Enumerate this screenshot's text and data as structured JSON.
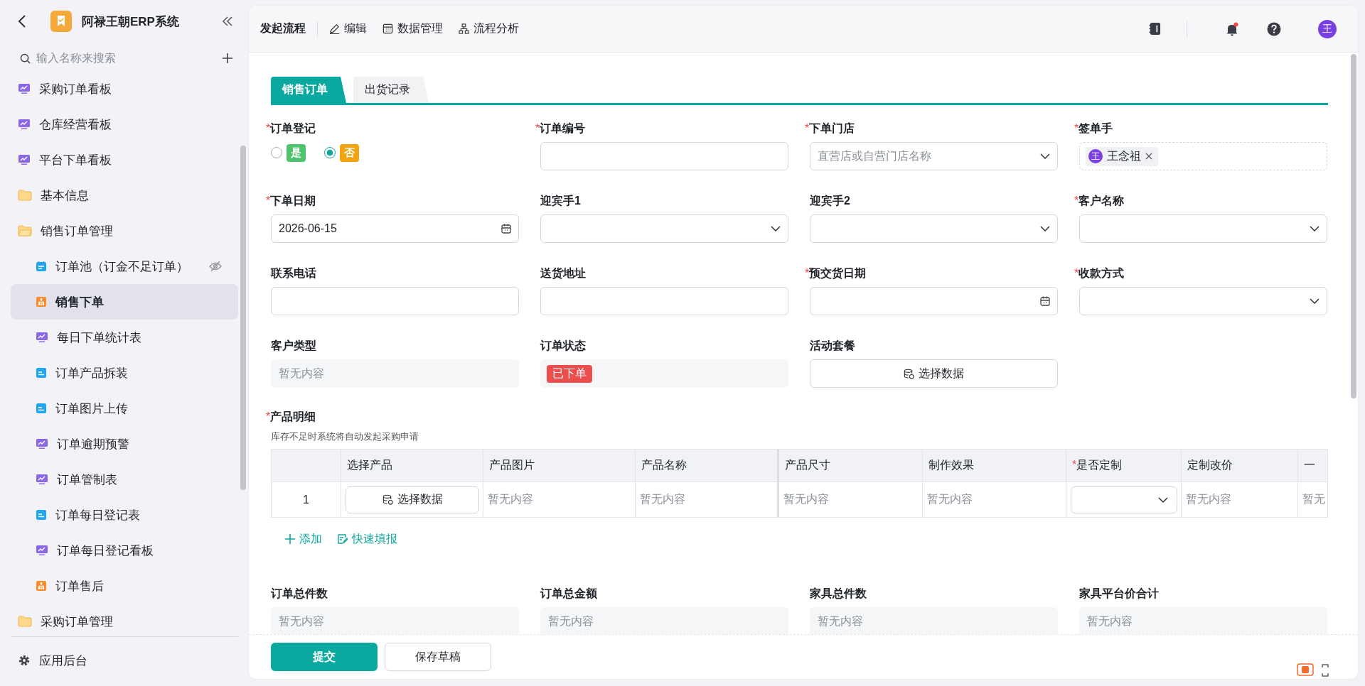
{
  "sidebar": {
    "title": "阿禄王朝ERP系统",
    "search": {
      "placeholder": "输入名称来搜索"
    },
    "items": [
      {
        "label": "采购订单看板",
        "kind": "chart",
        "selected": false
      },
      {
        "label": "仓库经营看板",
        "kind": "chart",
        "selected": false
      },
      {
        "label": "平台下单看板",
        "kind": "chart",
        "selected": false
      },
      {
        "label": "基本信息",
        "kind": "folder",
        "expanded": false,
        "selected": false
      },
      {
        "label": "销售订单管理",
        "kind": "folder",
        "expanded": true,
        "selected": false,
        "children": [
          {
            "label": "订单池（订金不足订单）",
            "kind": "calendar",
            "selected": false,
            "hidden": true
          },
          {
            "label": "销售下单",
            "kind": "flow",
            "selected": true,
            "hidden": false
          },
          {
            "label": "每日下单统计表",
            "kind": "chart",
            "selected": false,
            "hidden": false
          },
          {
            "label": "订单产品拆装",
            "kind": "doc",
            "selected": false,
            "hidden": false
          },
          {
            "label": "订单图片上传",
            "kind": "doc",
            "selected": false,
            "hidden": false
          },
          {
            "label": "订单逾期预警",
            "kind": "chart",
            "selected": false,
            "hidden": false
          },
          {
            "label": "订单管制表",
            "kind": "chart",
            "selected": false,
            "hidden": false
          },
          {
            "label": "订单每日登记表",
            "kind": "doc",
            "selected": false,
            "hidden": false
          },
          {
            "label": "订单每日登记看板",
            "kind": "chart",
            "selected": false,
            "hidden": false
          },
          {
            "label": "订单售后",
            "kind": "flow",
            "selected": false,
            "hidden": false
          }
        ]
      },
      {
        "label": "采购订单管理",
        "kind": "folder",
        "expanded": false,
        "selected": false
      }
    ],
    "footer": {
      "label": "应用后台"
    }
  },
  "toolbar": {
    "title": "发起流程",
    "actions": [
      {
        "label": "编辑",
        "kind": "pencil"
      },
      {
        "label": "数据管理",
        "kind": "table"
      },
      {
        "label": "流程分析",
        "kind": "flow"
      }
    ],
    "notification": true,
    "avatar": "王"
  },
  "tabs": [
    {
      "label": "销售订单",
      "selected": true
    },
    {
      "label": "出货记录",
      "selected": false
    }
  ],
  "fields": [
    {
      "label": "订单登记",
      "required_mark": "*",
      "kind": "radio",
      "options": [
        {
          "label": "是",
          "color": "#4dc46c",
          "selected": false
        },
        {
          "label": "否",
          "color": "#f2a30f",
          "selected": true
        }
      ]
    },
    {
      "label": "订单编号",
      "required_mark": "*",
      "kind": "input"
    },
    {
      "label": "下单门店",
      "required_mark": "*",
      "kind": "select",
      "placeholder": "直营店或自营门店名称"
    },
    {
      "label": "签单手",
      "required_mark": "*",
      "kind": "person",
      "avatar": "王",
      "value": "王念祖"
    },
    {
      "label": "下单日期",
      "required_mark": "*",
      "kind": "date",
      "value": "2026-06-15"
    },
    {
      "label": "迎宾手1",
      "kind": "select"
    },
    {
      "label": "迎宾手2",
      "kind": "select"
    },
    {
      "label": "客户名称",
      "required_mark": "*",
      "kind": "select"
    },
    {
      "label": "联系电话",
      "kind": "input"
    },
    {
      "label": "送货地址",
      "kind": "input"
    },
    {
      "label": "预交货日期",
      "required_mark": "*",
      "kind": "date"
    },
    {
      "label": "收款方式",
      "required_mark": "*",
      "kind": "select"
    },
    {
      "label": "客户类型",
      "kind": "readonly",
      "placeholder": "暂无内容"
    },
    {
      "label": "订单状态",
      "kind": "status",
      "value": "已下单"
    },
    {
      "label": "活动套餐",
      "kind": "data",
      "value": "选择数据"
    }
  ],
  "products": {
    "label": "产品明细",
    "required_mark": "*",
    "hint": "库存不足时系统将自动发起采购申请",
    "columns": [
      {},
      {
        "label": "选择产品"
      },
      {
        "label": "产品图片"
      },
      {
        "label": "产品名称"
      },
      {
        "label": "产品尺寸"
      },
      {
        "label": "制作效果"
      },
      {
        "label": "是否定制",
        "required_mark": "*"
      },
      {
        "label": "定制改价"
      },
      {
        "label": "一"
      }
    ],
    "rows": [
      {
        "cells": [
          {
            "kind": "index",
            "text": "1"
          },
          {
            "kind": "button",
            "text": "选择数据"
          },
          {
            "kind": "empty",
            "text": "暂无内容"
          },
          {
            "kind": "empty",
            "text": "暂无内容"
          },
          {
            "kind": "empty",
            "text": "暂无内容"
          },
          {
            "kind": "empty",
            "text": "暂无内容"
          },
          {
            "kind": "select"
          },
          {
            "kind": "empty",
            "text": "暂无内容"
          },
          {
            "kind": "empty",
            "text": "暂无"
          }
        ]
      }
    ],
    "links": [
      {
        "label": "添加",
        "kind": "plus"
      },
      {
        "label": "快速填报",
        "kind": "quick"
      }
    ]
  },
  "totals": [
    {
      "label": "订单总件数",
      "placeholder": "暂无内容"
    },
    {
      "label": "订单总金额",
      "placeholder": "暂无内容"
    },
    {
      "label": "家具总件数",
      "placeholder": "暂无内容"
    },
    {
      "label": "家具平台价合计",
      "placeholder": "暂无内容"
    }
  ],
  "buttons": [
    {
      "label": "提交",
      "kind": "primary"
    },
    {
      "label": "保存草稿",
      "kind": "default"
    }
  ]
}
